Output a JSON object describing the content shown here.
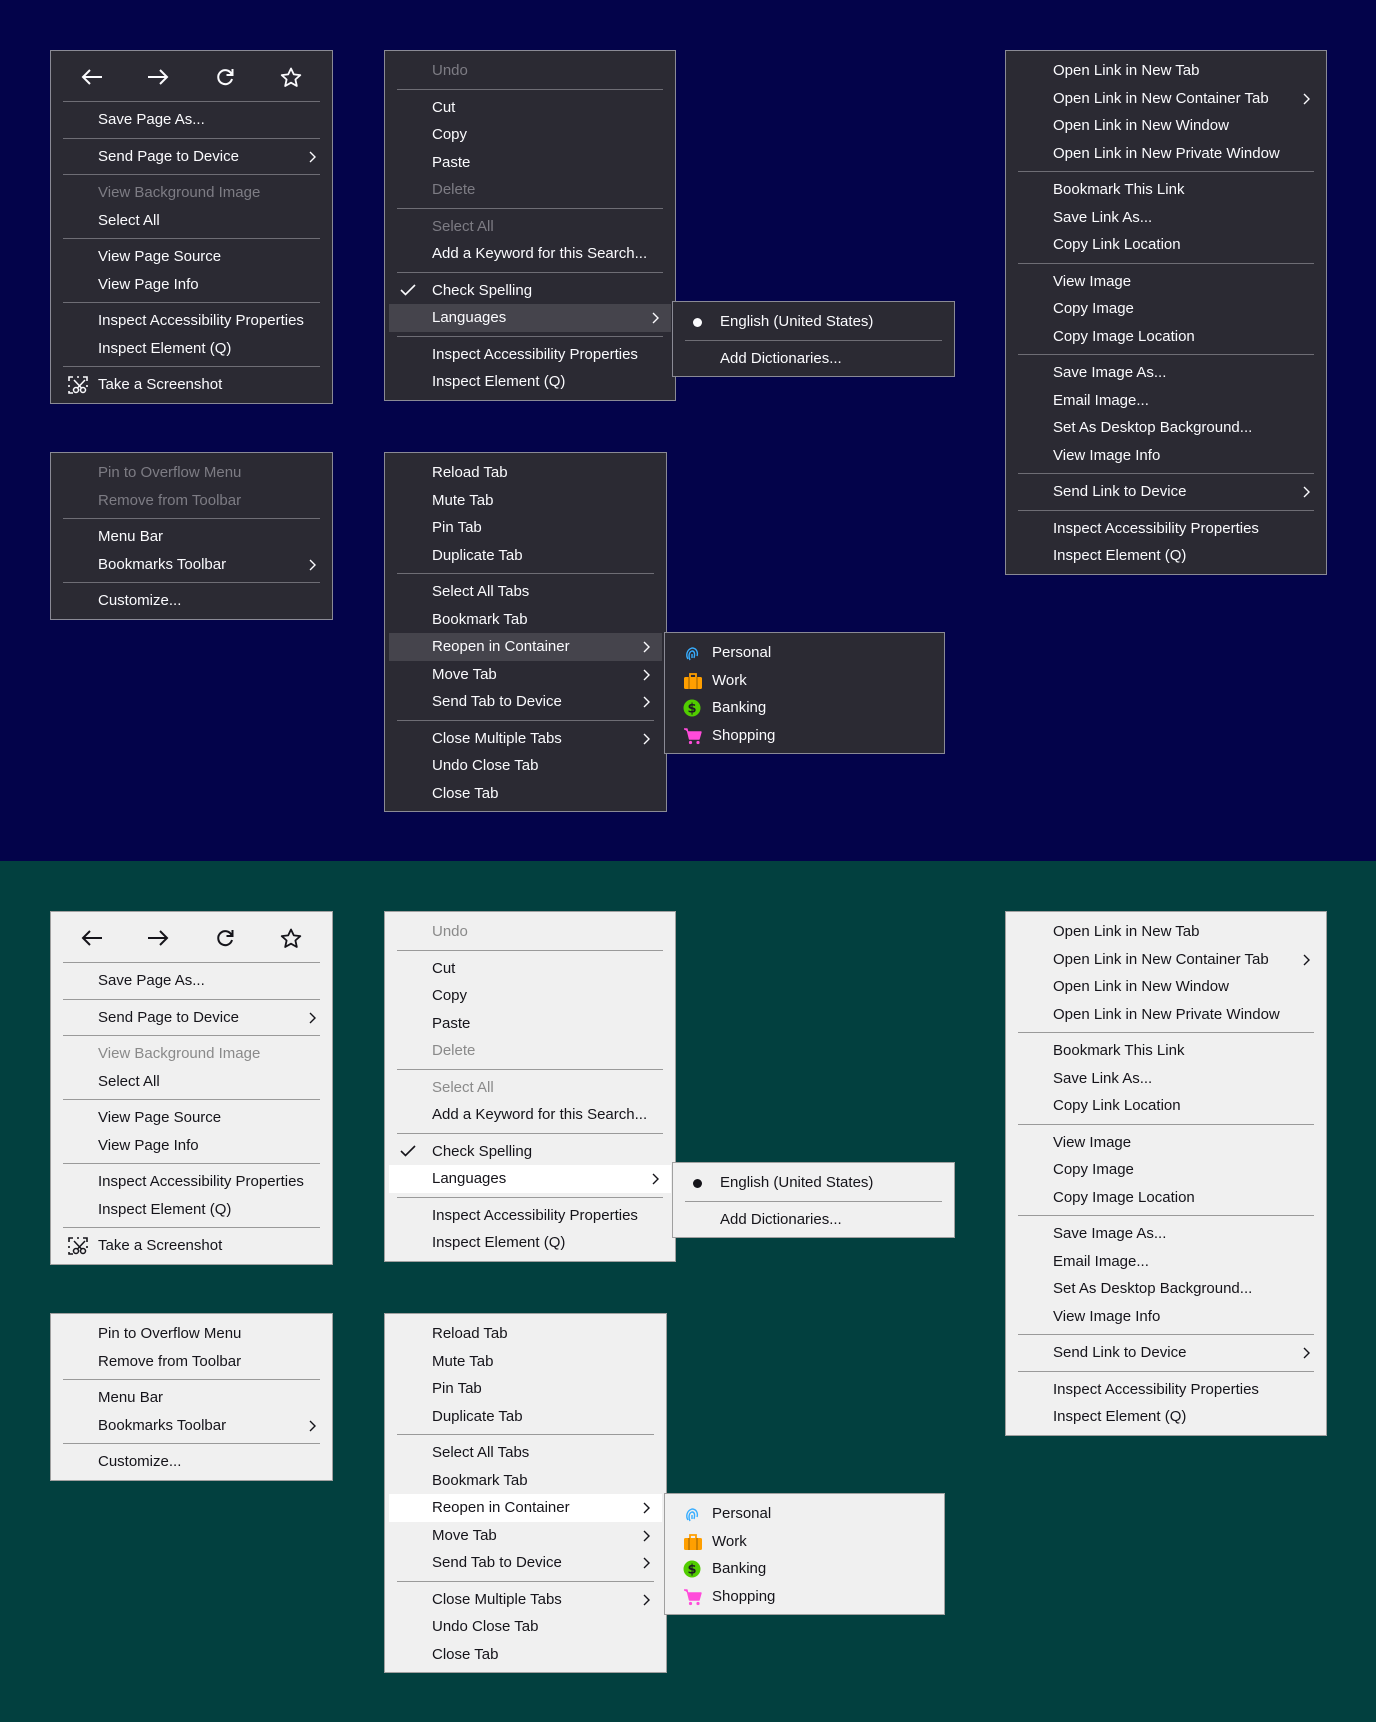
{
  "page_menu": {
    "nav": [
      "back-icon",
      "forward-icon",
      "reload-icon",
      "bookmark-star-icon"
    ],
    "items": [
      {
        "label": "Save Page As...",
        "disabled": false
      },
      {
        "sep": true
      },
      {
        "label": "Send Page to Device",
        "submenu": true
      },
      {
        "sep": true
      },
      {
        "label": "View Background Image",
        "disabled": true
      },
      {
        "label": "Select All"
      },
      {
        "sep": true
      },
      {
        "label": "View Page Source"
      },
      {
        "label": "View Page Info"
      },
      {
        "sep": true
      },
      {
        "label": "Inspect Accessibility Properties"
      },
      {
        "label": "Inspect Element (Q)"
      },
      {
        "sep": true
      },
      {
        "label": "Take a Screenshot",
        "icon": "screenshot-icon"
      }
    ]
  },
  "edit_menu": {
    "items": [
      {
        "label": "Undo",
        "disabled": true
      },
      {
        "sep": true
      },
      {
        "label": "Cut"
      },
      {
        "label": "Copy"
      },
      {
        "label": "Paste"
      },
      {
        "label": "Delete",
        "disabled": true
      },
      {
        "sep": true
      },
      {
        "label": "Select All",
        "disabled": true
      },
      {
        "label": "Add a Keyword for this Search..."
      },
      {
        "sep": true
      },
      {
        "label": "Check Spelling",
        "checked": true
      },
      {
        "label": "Languages",
        "submenu": true,
        "hover": true
      },
      {
        "sep": true
      },
      {
        "label": "Inspect Accessibility Properties"
      },
      {
        "label": "Inspect Element (Q)"
      }
    ]
  },
  "languages_menu": {
    "items": [
      {
        "label": "English (United States)",
        "radio": true
      },
      {
        "sep": true
      },
      {
        "label": "Add Dictionaries..."
      }
    ]
  },
  "link_menu": {
    "items": [
      {
        "label": "Open Link in New Tab"
      },
      {
        "label": "Open Link in New Container Tab",
        "submenu": true
      },
      {
        "label": "Open Link in New Window"
      },
      {
        "label": "Open Link in New Private Window"
      },
      {
        "sep": true
      },
      {
        "label": "Bookmark This Link"
      },
      {
        "label": "Save Link As..."
      },
      {
        "label": "Copy Link Location"
      },
      {
        "sep": true
      },
      {
        "label": "View Image"
      },
      {
        "label": "Copy Image"
      },
      {
        "label": "Copy Image Location"
      },
      {
        "sep": true
      },
      {
        "label": "Save Image As..."
      },
      {
        "label": "Email Image..."
      },
      {
        "label": "Set As Desktop Background..."
      },
      {
        "label": "View Image Info"
      },
      {
        "sep": true
      },
      {
        "label": "Send Link to Device",
        "submenu": true
      },
      {
        "sep": true
      },
      {
        "label": "Inspect Accessibility Properties"
      },
      {
        "label": "Inspect Element (Q)"
      }
    ]
  },
  "toolbar_menu": {
    "items": [
      {
        "label": "Pin to Overflow Menu",
        "disabled_dark": true
      },
      {
        "label": "Remove from Toolbar",
        "disabled_dark": true
      },
      {
        "sep": true
      },
      {
        "label": "Menu Bar"
      },
      {
        "label": "Bookmarks Toolbar",
        "submenu": true
      },
      {
        "sep": true
      },
      {
        "label": "Customize..."
      }
    ]
  },
  "tab_menu": {
    "items": [
      {
        "label": "Reload Tab"
      },
      {
        "label": "Mute Tab"
      },
      {
        "label": "Pin Tab"
      },
      {
        "label": "Duplicate Tab"
      },
      {
        "sep": true
      },
      {
        "label": "Select All Tabs"
      },
      {
        "label": "Bookmark Tab"
      },
      {
        "label": "Reopen in Container",
        "submenu": true,
        "hover": true
      },
      {
        "label": "Move Tab",
        "submenu": true
      },
      {
        "label": "Send Tab to Device",
        "submenu": true
      },
      {
        "sep": true
      },
      {
        "label": "Close Multiple Tabs",
        "submenu": true
      },
      {
        "label": "Undo Close Tab"
      },
      {
        "label": "Close Tab"
      }
    ]
  },
  "container_menu": {
    "items": [
      {
        "label": "Personal",
        "icon": "fingerprint-icon",
        "color": "#37adff"
      },
      {
        "label": "Work",
        "icon": "briefcase-icon",
        "color": "#ff9f00"
      },
      {
        "label": "Banking",
        "icon": "dollar-icon",
        "color": "#51cd00"
      },
      {
        "label": "Shopping",
        "icon": "cart-icon",
        "color": "#ff4bda"
      }
    ]
  },
  "colors": {
    "dark_bg": "#03034a",
    "light_bg": "#02403f"
  }
}
